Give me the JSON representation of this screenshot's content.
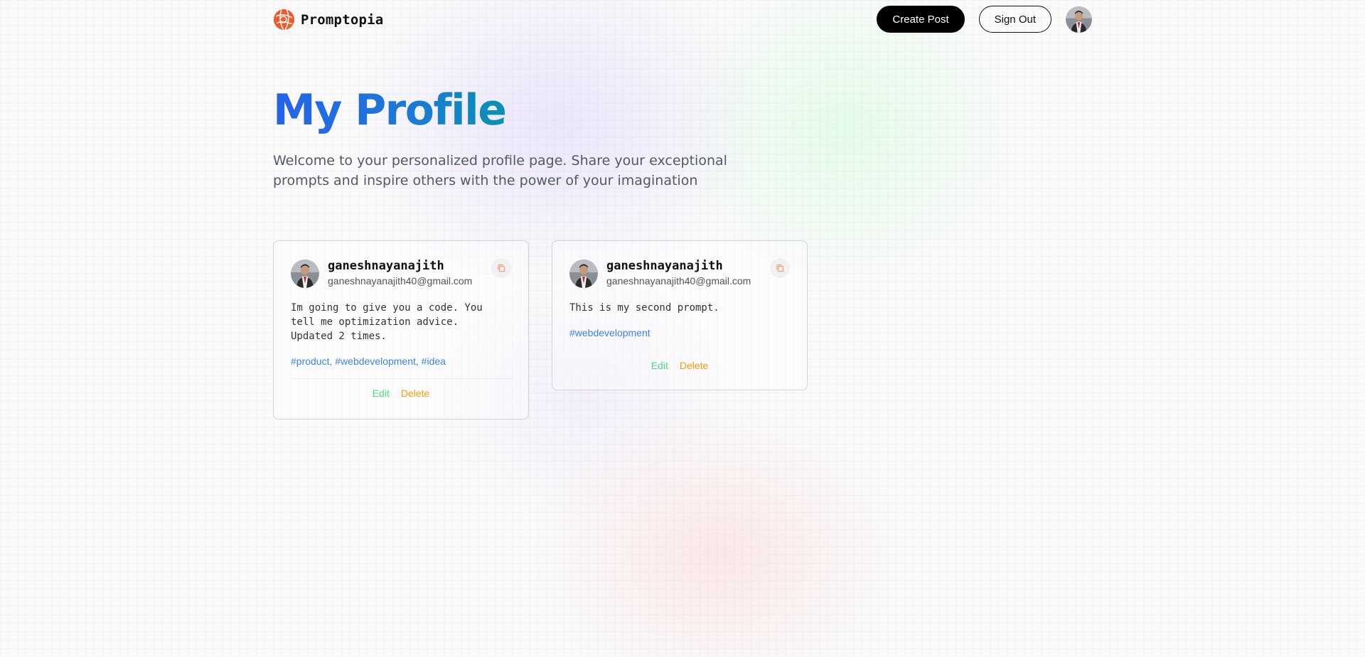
{
  "nav": {
    "brand": "Promptopia",
    "create_post": "Create Post",
    "sign_out": "Sign Out",
    "logo_icon": "globe-logo-icon",
    "avatar_icon": "user-avatar"
  },
  "hero": {
    "title": "My Profile",
    "subtitle": "Welcome to your personalized profile page. Share your exceptional prompts and inspire others with the power of your imagination"
  },
  "colors": {
    "brand_orange": "#f05a28",
    "title_gradient_start": "#2563eb",
    "title_gradient_end": "#0891b2",
    "tag_blue": "#3b82f6",
    "edit_green": "#4ade80",
    "delete_orange": "#f59e0b"
  },
  "posts": [
    {
      "username": "ganeshnayanajith",
      "email": "ganeshnayanajith40@gmail.com",
      "prompt": "Im going to give you a code. You\ntell me optimization advice.\nUpdated 2 times.",
      "tags": "#product, #webdevelopment, #idea",
      "edit": "Edit",
      "delete": "Delete",
      "copy_icon": "copy-icon"
    },
    {
      "username": "ganeshnayanajith",
      "email": "ganeshnayanajith40@gmail.com",
      "prompt": "This is my second prompt.",
      "tags": "#webdevelopment",
      "edit": "Edit",
      "delete": "Delete",
      "copy_icon": "copy-icon"
    }
  ]
}
